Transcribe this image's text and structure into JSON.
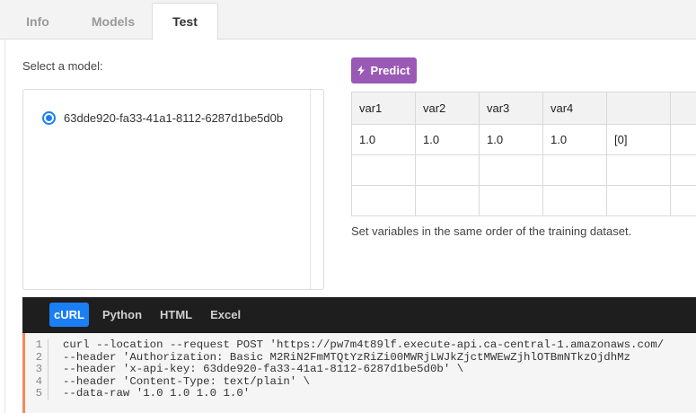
{
  "tabs": [
    {
      "label": "Info"
    },
    {
      "label": "Models"
    },
    {
      "label": "Test"
    }
  ],
  "select_label": "Select a model:",
  "models": [
    {
      "id": "63dde920-fa33-41a1-8112-6287d1be5d0b",
      "selected": true
    }
  ],
  "predict_button": "Predict",
  "grid": {
    "headers": [
      "var1",
      "var2",
      "var3",
      "var4",
      "",
      ""
    ],
    "rows": [
      [
        "1.0",
        "1.0",
        "1.0",
        "1.0",
        "[0]",
        ""
      ],
      [
        "",
        "",
        "",
        "",
        "",
        ""
      ],
      [
        "",
        "",
        "",
        "",
        "",
        ""
      ]
    ]
  },
  "hint": "Set variables in the same order of the training dataset.",
  "code_tabs": [
    "cURL",
    "Python",
    "HTML",
    "Excel"
  ],
  "code_lines": [
    "curl --location --request POST 'https://pw7m4t89lf.execute-api.ca-central-1.amazonaws.com/",
    "--header 'Authorization: Basic M2RiN2FmMTQtYzRiZi00MWRjLWJkZjctMWEwZjhlOTBmNTkzOjdhMz",
    "--header 'x-api-key: 63dde920-fa33-41a1-8112-6287d1be5d0b' \\",
    "--header 'Content-Type: text/plain' \\",
    "--data-raw '1.0 1.0 1.0 1.0'"
  ],
  "colors": {
    "accent_blue": "#1a7ff5",
    "predict_purple": "#9b59b6",
    "code_border": "#f08a5d"
  }
}
